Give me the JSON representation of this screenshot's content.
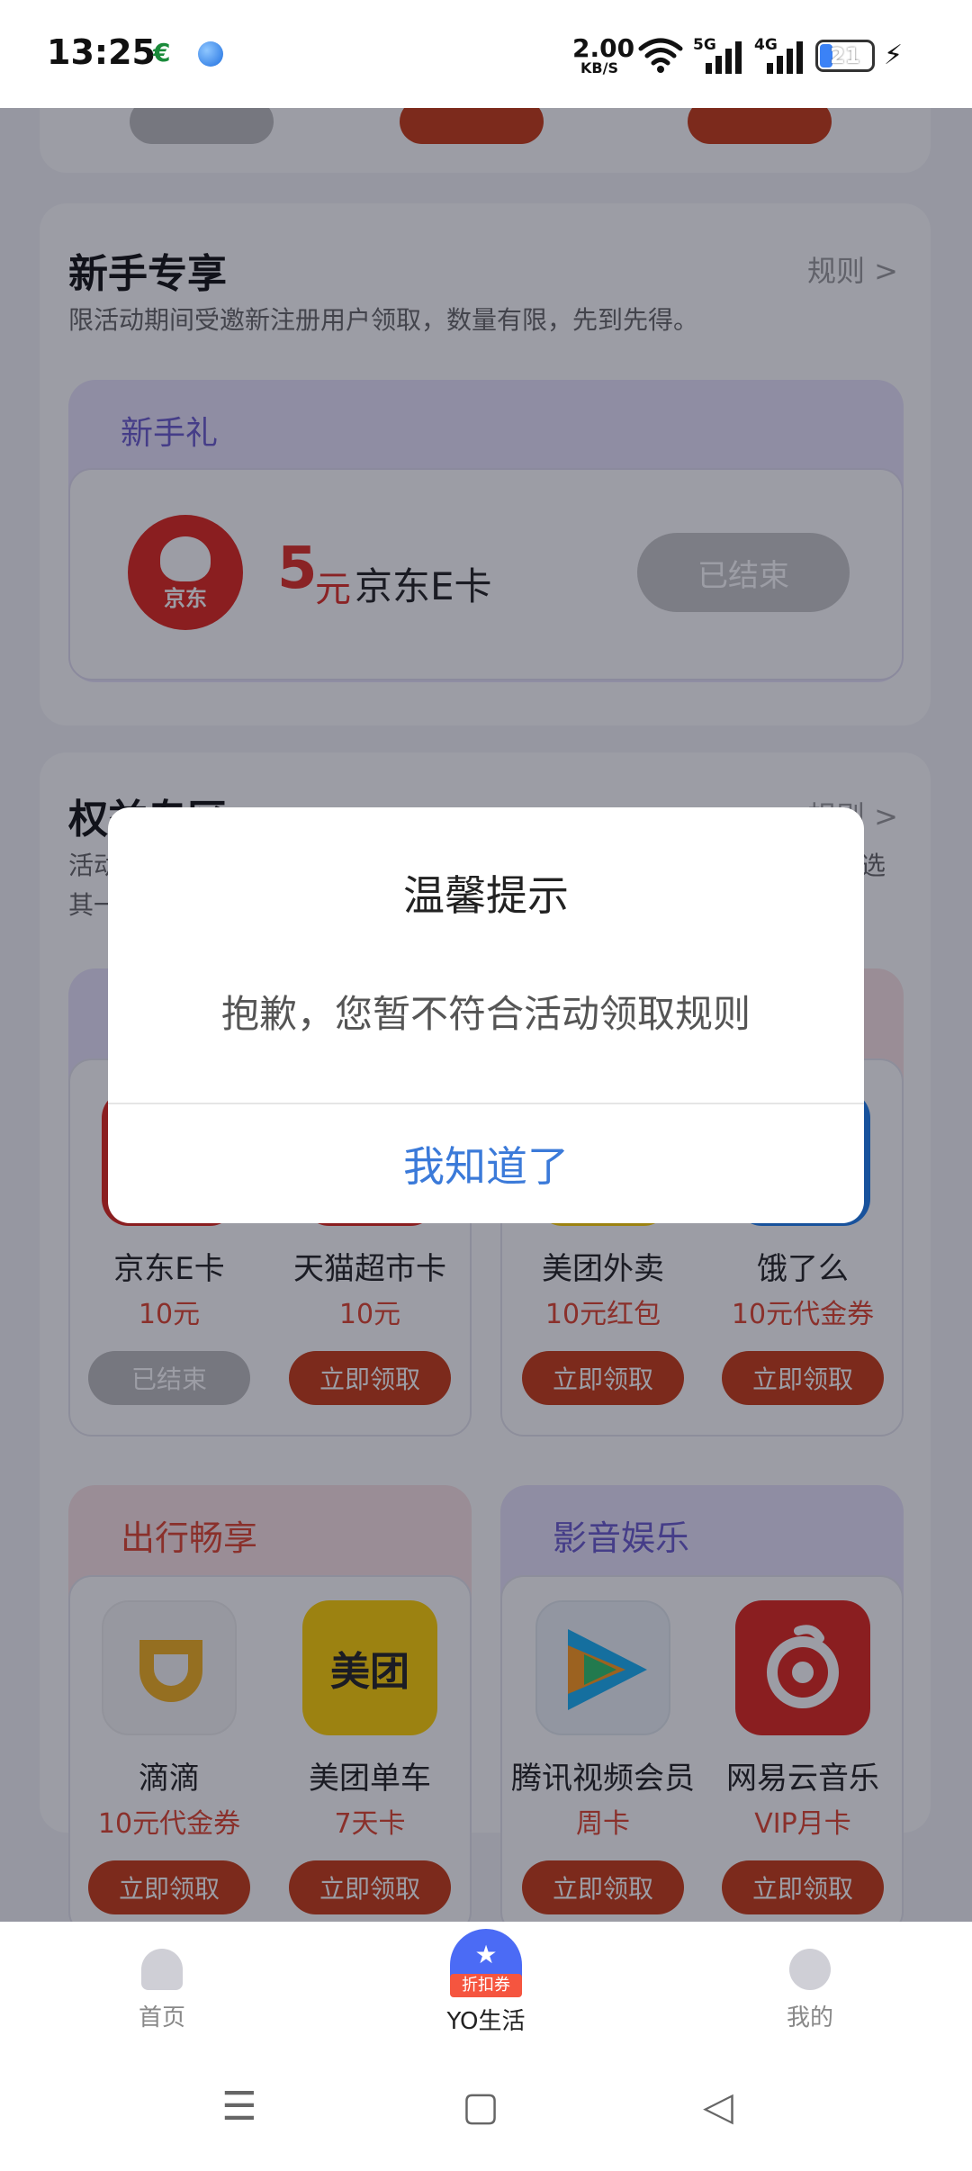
{
  "status_bar": {
    "time": "13:25",
    "net_speed_value": "2.00",
    "net_speed_unit": "KB/S",
    "sim1_type": "5G",
    "sim2_type": "4G",
    "battery": "21"
  },
  "newbie": {
    "title": "新手专享",
    "rule": "规则 >",
    "desc": "限活动期间受邀新注册用户领取，数量有限，先到先得。",
    "gift_label": "新手礼",
    "gift_logo_text": "京东",
    "gift_amount": "5",
    "gift_unit": "元",
    "gift_name": "京东E卡",
    "gift_button": "已结束"
  },
  "rights": {
    "title": "权益专区",
    "rule": "规则 >",
    "desc_left_line1": "活动",
    "desc_left_line2": "其一",
    "desc_right": "选",
    "items_row1": [
      {
        "name": "京东E卡",
        "value": "10元",
        "button": "已结束",
        "ended": true
      },
      {
        "name": "天猫超市卡",
        "value": "10元",
        "button": "立即领取",
        "ended": false
      },
      {
        "name": "美团外卖",
        "value": "10元红包",
        "button": "立即领取",
        "ended": false
      },
      {
        "name": "饿了么",
        "value": "10元代金券",
        "button": "立即领取",
        "ended": false
      }
    ],
    "travel_label": "出行畅享",
    "media_label": "影音娱乐",
    "items_row2": [
      {
        "name": "滴滴",
        "value": "10元代金券",
        "button": "立即领取",
        "icon": "didi-icon"
      },
      {
        "name": "美团单车",
        "value": "7天卡",
        "button": "立即领取",
        "icon": "meituan-icon",
        "logo_text": "美团"
      },
      {
        "name": "腾讯视频会员",
        "value": "周卡",
        "button": "立即领取",
        "icon": "tencent-video-icon"
      },
      {
        "name": "网易云音乐",
        "value": "VIP月卡",
        "button": "立即领取",
        "icon": "netease-music-icon"
      }
    ]
  },
  "bottom_nav": {
    "home": "首页",
    "yo": "YO生活",
    "yo_badge": "折扣券",
    "mine": "我的"
  },
  "dialog": {
    "title": "温馨提示",
    "message": "抱歉，您暂不符合活动领取规则",
    "confirm": "我知道了"
  },
  "colors": {
    "accent_red": "#e02e24",
    "button_red": "#c93a14",
    "dialog_link": "#3b7ad9"
  }
}
